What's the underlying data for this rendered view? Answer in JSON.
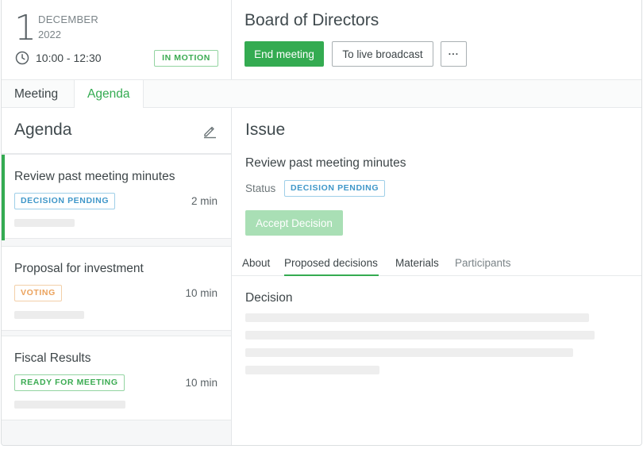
{
  "date": {
    "day": "1",
    "month": "DECEMBER",
    "year": "2022",
    "time": "10:00 - 12:30",
    "status_badge": "IN MOTION"
  },
  "meeting": {
    "title": "Board of Directors",
    "end_label": "End meeting",
    "broadcast_label": "To live broadcast",
    "more_label": "···"
  },
  "main_tabs": [
    {
      "label": "Meeting"
    },
    {
      "label": "Agenda"
    }
  ],
  "agenda": {
    "title": "Agenda",
    "items": [
      {
        "title": "Review past meeting minutes",
        "status": "DECISION PENDING",
        "duration": "2 min"
      },
      {
        "title": "Proposal for investment",
        "status": "VOTING",
        "duration": "10 min"
      },
      {
        "title": "Fiscal Results",
        "status": "READY FOR MEETING",
        "duration": "10 min"
      }
    ]
  },
  "issue": {
    "title": "Issue",
    "subject": "Review past meeting minutes",
    "status_label": "Status",
    "status": "DECISION PENDING",
    "accept_label": "Accept Decision",
    "tabs": [
      {
        "label": "About"
      },
      {
        "label": "Proposed decisions"
      },
      {
        "label": "Materials"
      },
      {
        "label": "Participants"
      }
    ],
    "decision_label": "Decision"
  },
  "colors": {
    "accent": "#34ab51",
    "pending": "#3f97c9",
    "voting": "#eba25c"
  },
  "icons": {
    "clock": "clock-icon",
    "edit": "pencil-icon"
  }
}
